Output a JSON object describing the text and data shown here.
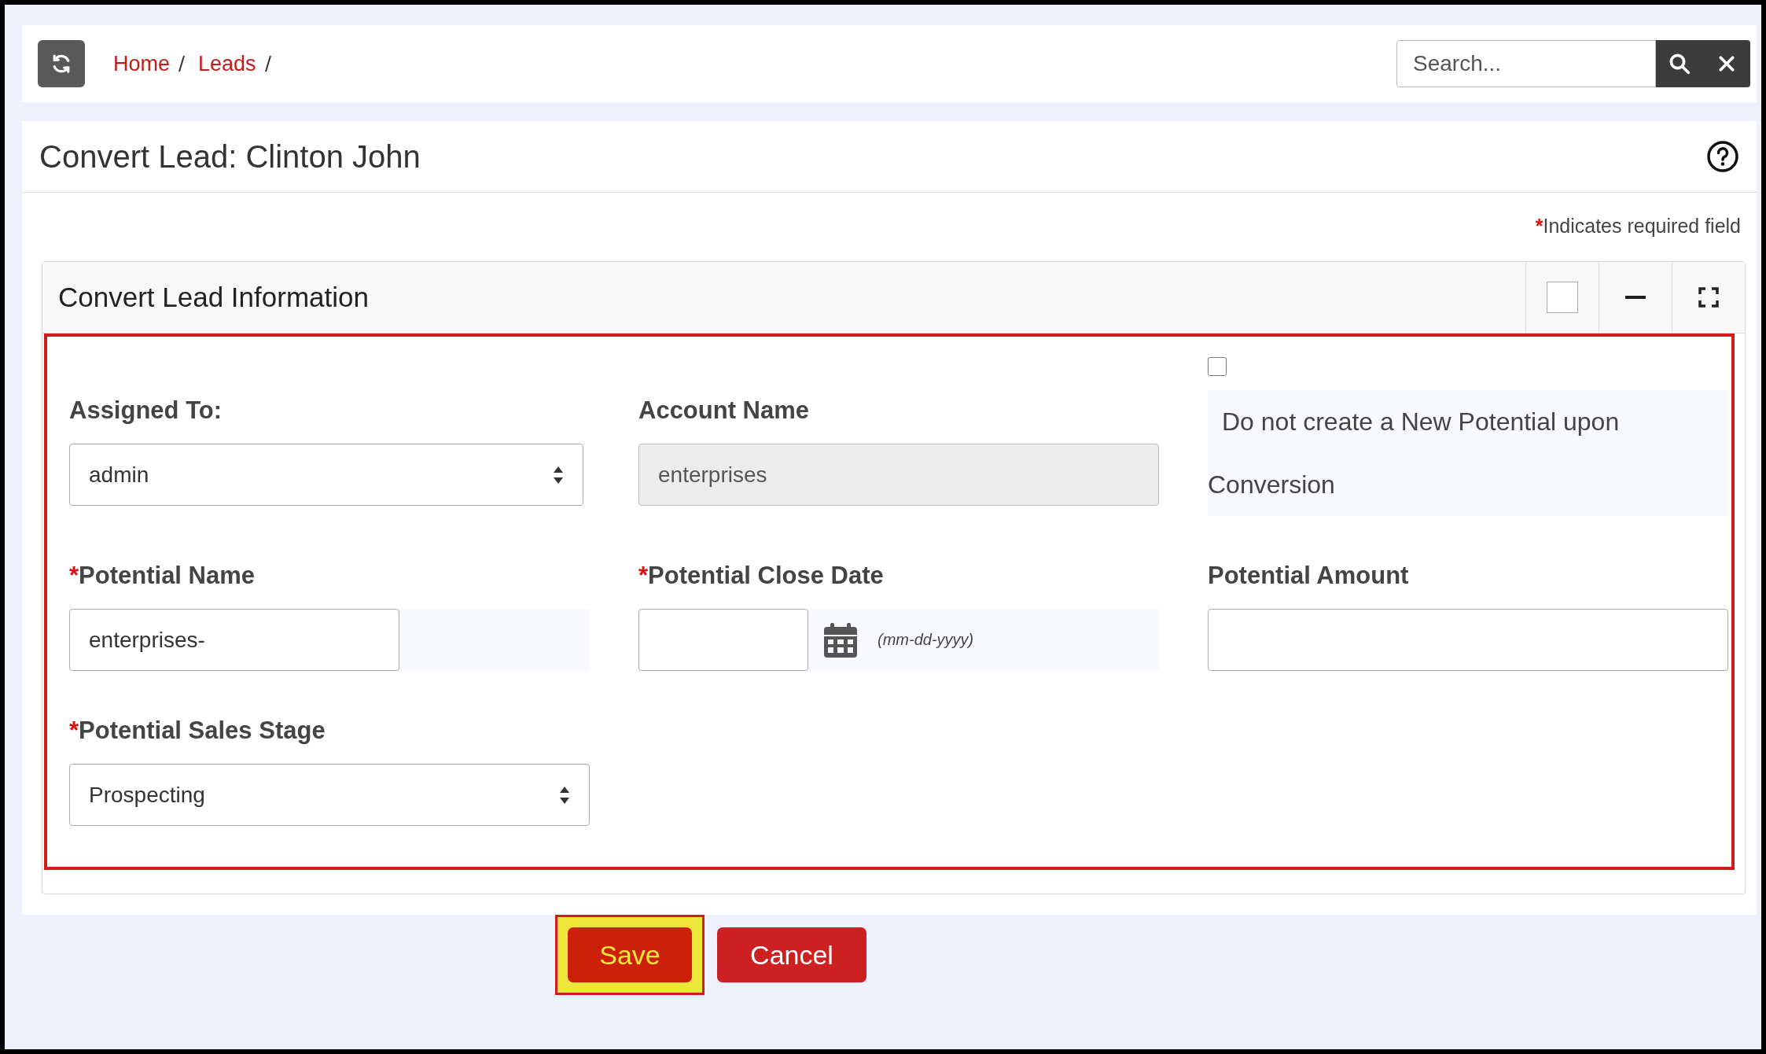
{
  "breadcrumbs": [
    {
      "label": "Home"
    },
    {
      "label": "Leads"
    }
  ],
  "search": {
    "placeholder": "Search..."
  },
  "page_title": "Convert Lead: Clinton John",
  "required_note": {
    "mark": "*",
    "text": "Indicates required field"
  },
  "panel": {
    "title": "Convert Lead Information",
    "highlighted": true,
    "fields": [
      {
        "kind": "select",
        "label": "Assigned To:",
        "required": false,
        "value": "admin"
      },
      {
        "kind": "readonly",
        "label": "Account Name",
        "required": false,
        "value": "enterprises"
      },
      {
        "kind": "checkbox",
        "label": "Do not create a New Potential upon Conversion",
        "checked": false
      },
      {
        "kind": "text",
        "label": "Potential Name",
        "required": true,
        "value": "enterprises-"
      },
      {
        "kind": "date",
        "label": "Potential Close Date",
        "required": true,
        "hint": "(mm-dd-yyyy)"
      },
      {
        "kind": "text",
        "label": "Potential Amount",
        "required": false
      },
      {
        "kind": "select",
        "label": "Potential Sales Stage",
        "required": true,
        "value": "Prospecting"
      }
    ]
  },
  "buttons": [
    {
      "label": "Save",
      "kind": "primary",
      "highlighted": true
    },
    {
      "label": "Cancel",
      "kind": "secondary",
      "highlighted": false
    }
  ]
}
